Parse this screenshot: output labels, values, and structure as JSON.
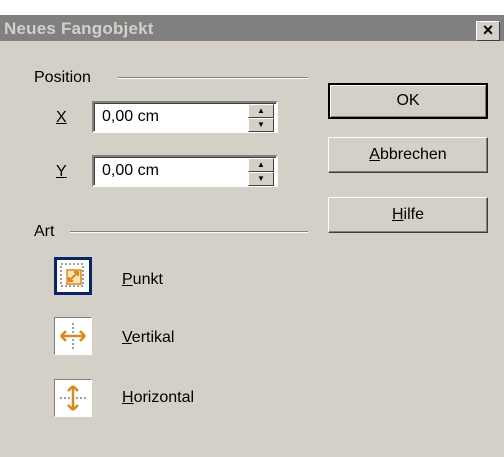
{
  "window": {
    "title": "Neues Fangobjekt",
    "close_symbol": "✕"
  },
  "position": {
    "group_label": "Position",
    "x": {
      "label": "X",
      "value": "0,00 cm"
    },
    "y": {
      "label": "Y",
      "value": "0,00 cm"
    }
  },
  "art": {
    "group_label": "Art",
    "options": [
      {
        "label": "Punkt",
        "icon": "snap-point-icon",
        "selected": true
      },
      {
        "label": "Vertikal",
        "icon": "snap-vertical-icon",
        "selected": false
      },
      {
        "label": "Horizontal",
        "icon": "snap-horizontal-icon",
        "selected": false
      }
    ]
  },
  "buttons": {
    "ok": "OK",
    "cancel": "Abbrechen",
    "help": "Hilfe"
  },
  "colors": {
    "dialog_bg": "#d4d0c8",
    "titlebar_bg": "#808080",
    "icon_accent": "#d98a1e",
    "selection": "#0a246a"
  }
}
